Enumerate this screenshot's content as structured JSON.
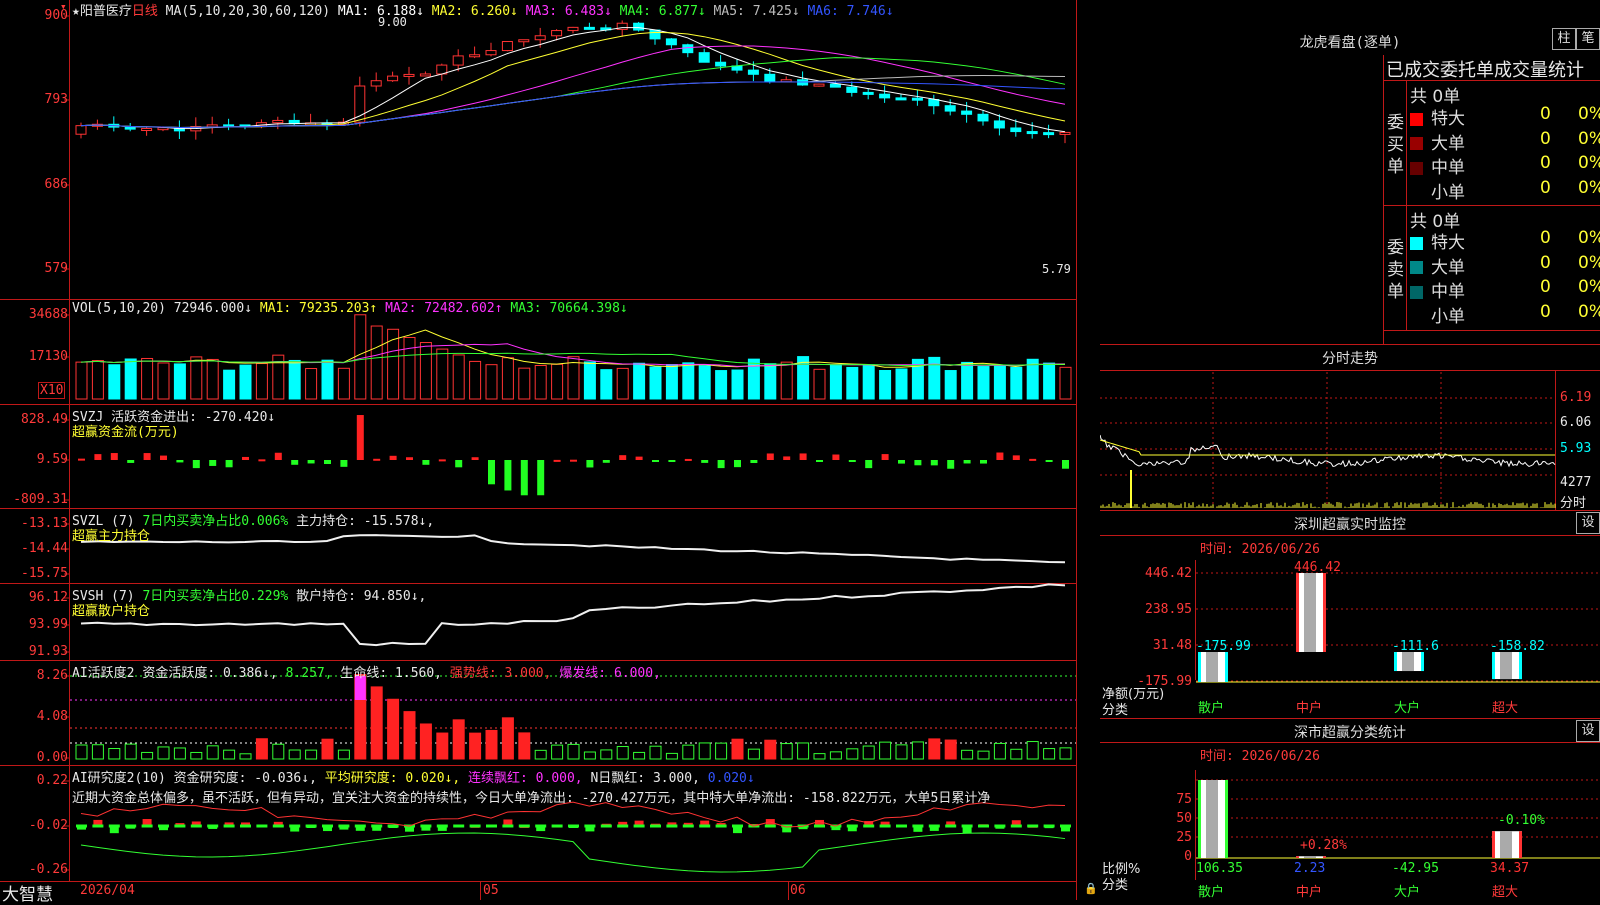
{
  "window": {
    "brand": "大智慧",
    "title_star": "★阳普医疗",
    "period": "日线"
  },
  "kline": {
    "ma_label": "MA(5,10,20,30,60,120)",
    "ma": [
      {
        "text": "MA1: 6.188↓",
        "color": "#ffffff"
      },
      {
        "text": "MA2: 6.260↓",
        "color": "#ffff33"
      },
      {
        "text": "MA3: 6.483↓",
        "color": "#ff33ff"
      },
      {
        "text": "MA4: 6.877↓",
        "color": "#33ff33"
      },
      {
        "text": "MA5: 7.425↓",
        "color": "#bbbbbb"
      },
      {
        "text": "MA6: 7.746↓",
        "color": "#3355ff"
      }
    ],
    "y_ticks": [
      "900",
      "793",
      "686",
      "579"
    ],
    "high_mark": "9.00",
    "low_mark": "5.79"
  },
  "vol": {
    "label": "VOL(5,10,20)",
    "value": "72946.000↓",
    "ma": [
      {
        "text": "MA1: 79235.203↑",
        "color": "#ffff33"
      },
      {
        "text": "MA2: 72482.602↑",
        "color": "#ff33ff"
      },
      {
        "text": "MA3: 70664.398↓",
        "color": "#33ff33"
      }
    ],
    "y_ticks": [
      "34688",
      "17130"
    ],
    "unit": "X10"
  },
  "svzj": {
    "label": "SVZJ",
    "desc": "活跃资金进出: -270.420↓",
    "title": "超赢资金流(万元)",
    "y_ticks": [
      "828.49",
      "9.59",
      "-809.31"
    ]
  },
  "svzl": {
    "label": "SVZL (7)",
    "desc1": "7日内买卖净占比0.006%",
    "desc2": "主力持仓: -15.578↓,",
    "title": "超赢主力持仓",
    "y_ticks": [
      "-13.13",
      "-14.44",
      "-15.75"
    ]
  },
  "svsh": {
    "label": "SVSH (7)",
    "desc1": "7日内买卖净占比0.229%",
    "desc2": "散户持仓: 94.850↓,",
    "title": "超赢散户持仓",
    "y_ticks": [
      "96.12",
      "93.99",
      "91.93"
    ]
  },
  "ai_active": {
    "label": "AI活跃度2",
    "items": [
      {
        "text": "资金活跃度: 0.386↓,",
        "color": "#e8e8e8"
      },
      {
        "text": "8.257,",
        "color": "#33ff33"
      },
      {
        "text": "生命线: 1.560,",
        "color": "#e8e8e8"
      },
      {
        "text": "强势线: 3.000,",
        "color": "#ff3a3a"
      },
      {
        "text": "爆发线: 6.000,",
        "color": "#ff33ff"
      }
    ],
    "y_ticks": [
      "8.26",
      "4.08",
      "0.00"
    ]
  },
  "ai_research": {
    "label": "AI研究度2(10)",
    "items": [
      {
        "text": "资金研究度: -0.036↓,",
        "color": "#e8e8e8"
      },
      {
        "text": "平均研究度: 0.020↓,",
        "color": "#ffff33"
      },
      {
        "text": "连续飘红: 0.000,",
        "color": "#ff33ff"
      },
      {
        "text": "N日飘红: 3.000,",
        "color": "#e8e8e8"
      },
      {
        "text": "0.020↓",
        "color": "#3355ff"
      }
    ],
    "comment": "近期大资金总体偏多，虽不活跃，但有异动，宜关注大资金的持续性，今日大单净流出: -270.427万元，其中特大单净流出: -158.822万元，大单5日累计净",
    "y_ticks": [
      "0.22",
      "-0.02",
      "-0.26"
    ]
  },
  "x_axis": {
    "labels": [
      "2026/04",
      "05",
      "06"
    ]
  },
  "longhu": {
    "title": "龙虎看盘(逐单)",
    "btn1": "柱",
    "btn2": "笔",
    "subtitle": "已成交委托单成交量统计",
    "buy": {
      "side_label": "委买单",
      "total": "共 0单",
      "rows": [
        {
          "name": "特大",
          "value": "0",
          "pct": "0%",
          "color": "#ff0000"
        },
        {
          "name": "大单",
          "value": "0",
          "pct": "0%",
          "color": "#990000"
        },
        {
          "name": "中单",
          "value": "0",
          "pct": "0%",
          "color": "#660000"
        },
        {
          "name": "小单",
          "value": "0",
          "pct": "0%",
          "color": "#000000"
        }
      ]
    },
    "sell": {
      "side_label": "委卖单",
      "total": "共 0单",
      "rows": [
        {
          "name": "特大",
          "value": "0",
          "pct": "0%",
          "color": "#00ffff"
        },
        {
          "name": "大单",
          "value": "0",
          "pct": "0%",
          "color": "#008888"
        },
        {
          "name": "中单",
          "value": "0",
          "pct": "0%",
          "color": "#006666"
        },
        {
          "name": "小单",
          "value": "0",
          "pct": "0%",
          "color": "#000000"
        }
      ]
    }
  },
  "intraday": {
    "title": "分时走势",
    "y_ticks": [
      "6.19",
      "6.06",
      "5.93"
    ],
    "vol_tick": "4277",
    "unit": "分时"
  },
  "monitor": {
    "title": "深圳超赢实时监控",
    "btn": "设",
    "time": "时间: 2026/06/26",
    "y_ticks": [
      "446.42",
      "238.95",
      "31.48",
      "-175.99"
    ],
    "y_label": "净额(万元)",
    "x_label": "分类",
    "categories": [
      "散户",
      "中户",
      "大户",
      "超大"
    ],
    "values": [
      "-175.99",
      "446.42",
      "-111.6",
      "-158.82"
    ]
  },
  "stats": {
    "title": "深市超赢分类统计",
    "btn": "设",
    "time": "时间: 2026/06/26",
    "y_ticks": [
      "75",
      "50",
      "25",
      "0"
    ],
    "y_label": "比例%",
    "x_label": "分类",
    "categories": [
      "散户",
      "中户",
      "大户",
      "超大"
    ],
    "values": [
      "106.35",
      "2.23",
      "-42.95",
      "34.37"
    ],
    "notes": [
      "+0.28%",
      "-0.10%"
    ]
  }
}
